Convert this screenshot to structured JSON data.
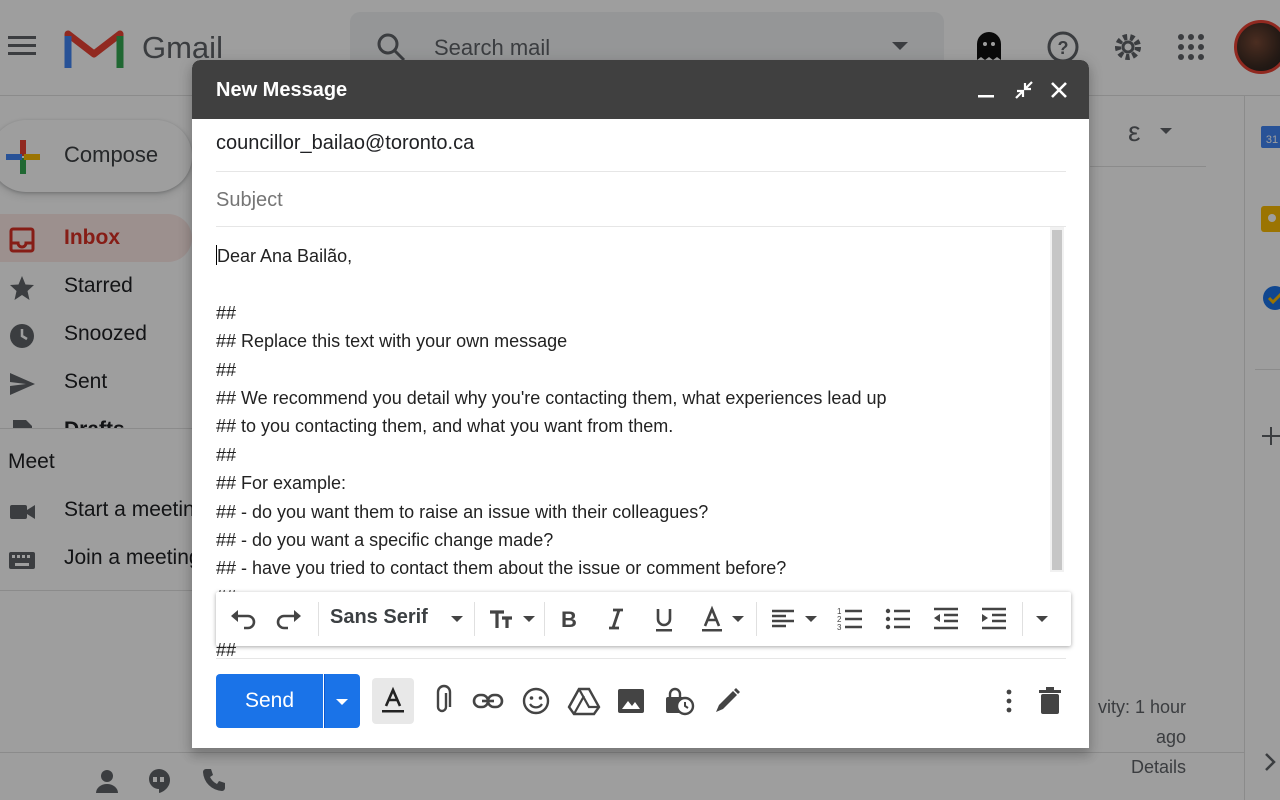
{
  "gmail": {
    "app_name": "Gmail",
    "search_placeholder": "Search mail",
    "compose_label": "Compose",
    "nav": [
      {
        "label": "Inbox",
        "icon": "inbox-icon"
      },
      {
        "label": "Starred",
        "icon": "star-icon"
      },
      {
        "label": "Snoozed",
        "icon": "clock-icon"
      },
      {
        "label": "Sent",
        "icon": "send-icon"
      },
      {
        "label": "Drafts",
        "icon": "draft-icon"
      }
    ],
    "meet_title": "Meet",
    "meet_items": [
      {
        "label": "Start a meeting",
        "icon": "video-icon"
      },
      {
        "label": "Join a meeting",
        "icon": "keyboard-icon"
      }
    ],
    "right_glyph": "ε",
    "activity_lines": [
      "vity: 1 hour",
      "ago",
      "Details"
    ]
  },
  "compose": {
    "title": "New Message",
    "to": "councillor_bailao@toronto.ca",
    "subject_placeholder": "Subject",
    "body_lines": [
      "Dear Ana Bailão,",
      "",
      "##",
      "## Replace this text with your own message",
      "##",
      "## We recommend you detail why you're contacting them, what experiences lead up",
      "## to you contacting them, and what you want from them.",
      "##",
      "## For example:",
      "## - do you want them to raise an issue with their colleagues?",
      "## - do you want a specific change made?",
      "## - have you tried to contact them about the issue or comment before?",
      "##"
    ],
    "trailing_line": "##",
    "font_name": "Sans Serif",
    "send_label": "Send"
  },
  "colors": {
    "accent": "#1a73e8",
    "header": "#404040",
    "inbox_red": "#d93025"
  }
}
